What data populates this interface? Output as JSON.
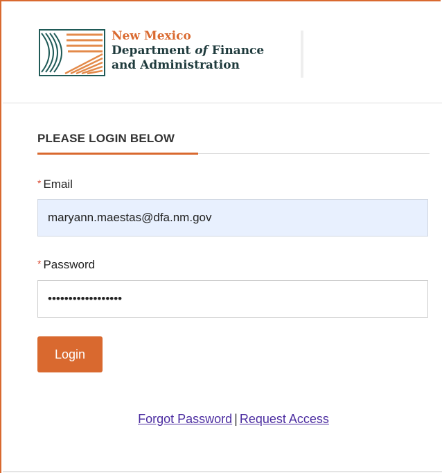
{
  "branding": {
    "line1": "New Mexico",
    "line2_pre": "Department ",
    "line2_italic": "of",
    "line2_post": " Finance",
    "line3": "and Administration",
    "logo_icon": "nm-dfa-logo-icon",
    "accent_color": "#d9692f",
    "dark_color": "#1f3b3d"
  },
  "login": {
    "section_title": "PLEASE LOGIN BELOW",
    "required_marker": "*",
    "email_label": "Email",
    "email_value": "maryann.maestas@dfa.nm.gov",
    "password_label": "Password",
    "password_value": "••••••••••••••••••",
    "login_button": "Login"
  },
  "links": {
    "forgot_password": "Forgot Password",
    "separator": "|",
    "request_access": "Request Access",
    "link_color": "#4b2ca0"
  }
}
